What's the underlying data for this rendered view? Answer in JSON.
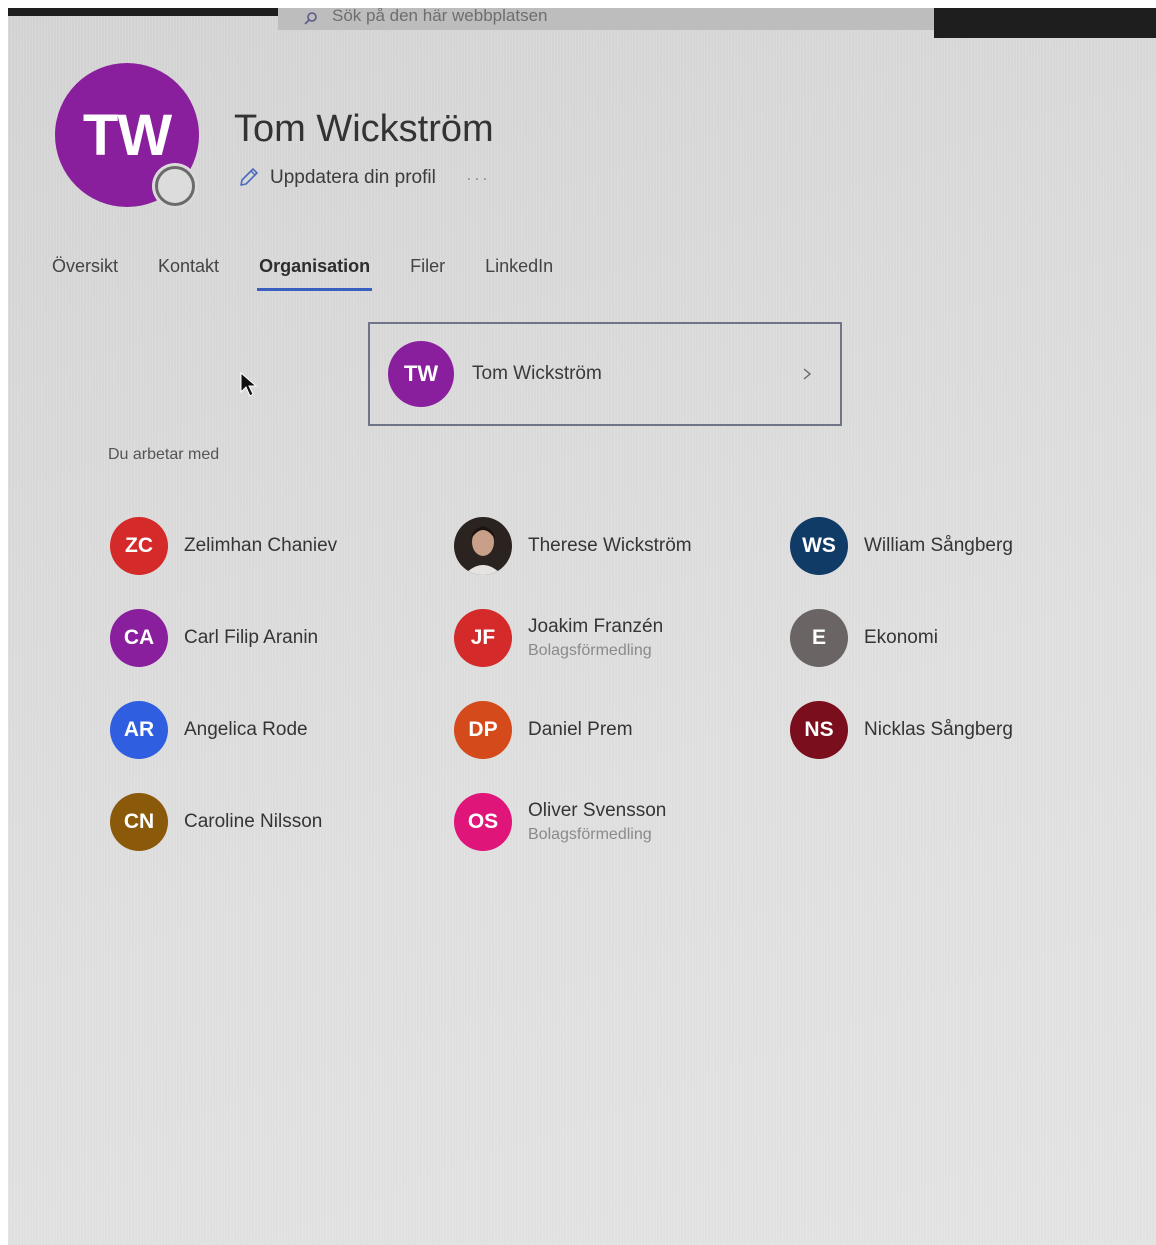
{
  "search": {
    "placeholder": "Sök på den här webbplatsen"
  },
  "profile": {
    "initials": "TW",
    "avatar_color": "#8a1f9e",
    "name": "Tom Wickström",
    "edit_label": "Uppdatera din profil",
    "more_label": "···"
  },
  "tabs": [
    {
      "label": "Översikt",
      "active": false
    },
    {
      "label": "Kontakt",
      "active": false
    },
    {
      "label": "Organisation",
      "active": true
    },
    {
      "label": "Filer",
      "active": false
    },
    {
      "label": "LinkedIn",
      "active": false
    }
  ],
  "manager": {
    "initials": "TW",
    "name": "Tom Wickström",
    "color": "#8a1f9e"
  },
  "works_with_label": "Du arbetar med",
  "people": [
    {
      "initials": "ZC",
      "name": "Zelimhan Chaniev",
      "sub": "",
      "color": "#d42a2a"
    },
    {
      "initials": "",
      "name": "Therese Wickström",
      "sub": "",
      "color": "",
      "photo": true
    },
    {
      "initials": "WS",
      "name": "William Sångberg",
      "sub": "",
      "color": "#0f3b66"
    },
    {
      "initials": "CA",
      "name": "Carl Filip Aranin",
      "sub": "",
      "color": "#8a1f9e"
    },
    {
      "initials": "JF",
      "name": "Joakim Franzén",
      "sub": "Bolagsförmedling",
      "color": "#d42a2a"
    },
    {
      "initials": "E",
      "name": "Ekonomi",
      "sub": "",
      "color": "#6b6464"
    },
    {
      "initials": "AR",
      "name": "Angelica Rode",
      "sub": "",
      "color": "#2f5fe0"
    },
    {
      "initials": "DP",
      "name": "Daniel Prem",
      "sub": "",
      "color": "#d44a1a"
    },
    {
      "initials": "NS",
      "name": "Nicklas Sångberg",
      "sub": "",
      "color": "#7a0e1c"
    },
    {
      "initials": "CN",
      "name": "Caroline Nilsson",
      "sub": "",
      "color": "#8a5a0a"
    },
    {
      "initials": "OS",
      "name": "Oliver Svensson",
      "sub": "Bolagsförmedling",
      "color": "#e0157a"
    }
  ]
}
